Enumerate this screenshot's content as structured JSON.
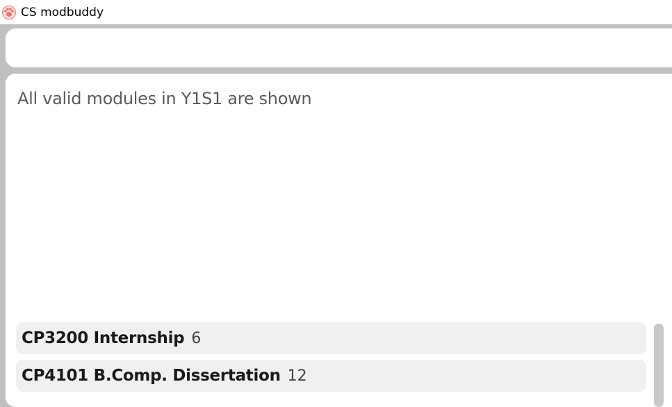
{
  "window": {
    "title": "CS modbuddy",
    "icon": "paw-icon"
  },
  "command_box": {
    "value": ""
  },
  "result": {
    "message": "All valid modules in Y1S1 are shown"
  },
  "modules": [
    {
      "code_title": "CP3200 Internship",
      "credits": "6"
    },
    {
      "code_title": "CP4101 B.Comp. Dissertation",
      "credits": "12"
    }
  ],
  "colors": {
    "background": "#c0c0c0",
    "panel": "#ffffff",
    "list_item": "#f0f0f0",
    "icon_accent": "#e8746a"
  }
}
